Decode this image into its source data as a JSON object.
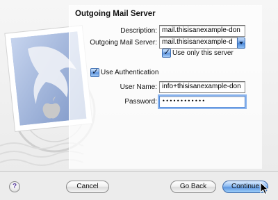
{
  "section": {
    "title": "Outgoing Mail Server"
  },
  "form": {
    "description": {
      "label": "Description:",
      "value": "mail.thisisanexample-don"
    },
    "server": {
      "label": "Outgoing Mail Server:",
      "value": "mail.thisisanexample-d"
    },
    "use_only_server": {
      "label": "Use only this server",
      "checked": true
    },
    "use_auth": {
      "label": "Use Authentication",
      "checked": true
    },
    "username": {
      "label": "User Name:",
      "value": "info+thisisanexample-don"
    },
    "password": {
      "label": "Password:",
      "value": "••••••••••••"
    }
  },
  "buttons": {
    "help": "?",
    "cancel": "Cancel",
    "back": "Go Back",
    "continue": "Continue"
  },
  "icons": {
    "help": "help-icon",
    "dropdown": "chevron-down-icon",
    "check": "checkmark-icon",
    "cursor": "mouse-pointer-icon",
    "stamp": "mail-stamp-illustration"
  },
  "colors": {
    "accent": "#5f97e0",
    "focus_ring": "#8ab4ee"
  }
}
